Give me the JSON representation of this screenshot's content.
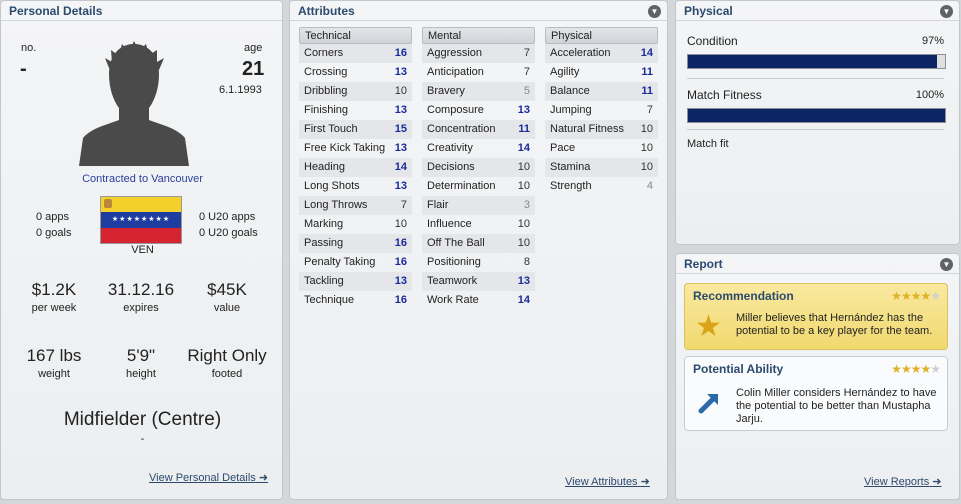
{
  "personal": {
    "title": "Personal Details",
    "no_label": "no.",
    "no_value": "-",
    "age_label": "age",
    "age_value": "21",
    "dob": "6.1.1993",
    "contract": "Contracted to Vancouver",
    "apps": "0 apps",
    "goals": "0 goals",
    "u20_apps": "0 U20 apps",
    "u20_goals": "0 U20 goals",
    "nation": "VEN",
    "wage_value": "$1.2K",
    "wage_label": "per week",
    "expires_value": "31.12.16",
    "expires_label": "expires",
    "value_value": "$45K",
    "value_label": "value",
    "weight_value": "167 lbs",
    "weight_label": "weight",
    "height_value": "5'9\"",
    "height_label": "height",
    "foot_value": "Right Only",
    "foot_label": "footed",
    "position": "Midfielder (Centre)",
    "position_sub": "-",
    "link": "View Personal Details"
  },
  "attributes": {
    "title": "Attributes",
    "link": "View Attributes",
    "technical": {
      "label": "Technical",
      "rows": [
        {
          "name": "Corners",
          "value": "16"
        },
        {
          "name": "Crossing",
          "value": "13"
        },
        {
          "name": "Dribbling",
          "value": "10"
        },
        {
          "name": "Finishing",
          "value": "13"
        },
        {
          "name": "First Touch",
          "value": "15"
        },
        {
          "name": "Free Kick Taking",
          "value": "13"
        },
        {
          "name": "Heading",
          "value": "14"
        },
        {
          "name": "Long Shots",
          "value": "13"
        },
        {
          "name": "Long Throws",
          "value": "7"
        },
        {
          "name": "Marking",
          "value": "10"
        },
        {
          "name": "Passing",
          "value": "16"
        },
        {
          "name": "Penalty Taking",
          "value": "16"
        },
        {
          "name": "Tackling",
          "value": "13"
        },
        {
          "name": "Technique",
          "value": "16"
        }
      ]
    },
    "mental": {
      "label": "Mental",
      "rows": [
        {
          "name": "Aggression",
          "value": "7"
        },
        {
          "name": "Anticipation",
          "value": "7"
        },
        {
          "name": "Bravery",
          "value": "5"
        },
        {
          "name": "Composure",
          "value": "13"
        },
        {
          "name": "Concentration",
          "value": "11"
        },
        {
          "name": "Creativity",
          "value": "14"
        },
        {
          "name": "Decisions",
          "value": "10"
        },
        {
          "name": "Determination",
          "value": "10"
        },
        {
          "name": "Flair",
          "value": "3"
        },
        {
          "name": "Influence",
          "value": "10"
        },
        {
          "name": "Off The Ball",
          "value": "10"
        },
        {
          "name": "Positioning",
          "value": "8"
        },
        {
          "name": "Teamwork",
          "value": "13"
        },
        {
          "name": "Work Rate",
          "value": "14"
        }
      ]
    },
    "physical": {
      "label": "Physical",
      "rows": [
        {
          "name": "Acceleration",
          "value": "14"
        },
        {
          "name": "Agility",
          "value": "11"
        },
        {
          "name": "Balance",
          "value": "11"
        },
        {
          "name": "Jumping",
          "value": "7"
        },
        {
          "name": "Natural Fitness",
          "value": "10"
        },
        {
          "name": "Pace",
          "value": "10"
        },
        {
          "name": "Stamina",
          "value": "10"
        },
        {
          "name": "Strength",
          "value": "4"
        }
      ]
    }
  },
  "physical": {
    "title": "Physical",
    "condition_label": "Condition",
    "condition_value": "97%",
    "condition_level": 0.97,
    "fitness_label": "Match Fitness",
    "fitness_value": "100%",
    "fitness_level": 1.0,
    "status": "Match fit"
  },
  "report": {
    "title": "Report",
    "link": "View Reports",
    "recommendation": {
      "title": "Recommendation",
      "text": "Miller believes that Hernández has the potential to be a key player for the team.",
      "stars": 4,
      "max_stars": 5
    },
    "potential": {
      "title": "Potential Ability",
      "text": "Colin Miller considers Hernández to have the potential to be better than Mustapha Jarju.",
      "stars": 4,
      "max_stars": 5
    }
  },
  "colors": {
    "accent": "#2b4a6e",
    "high_value": "#1a2a9c",
    "bar_fill": "#0c2565",
    "recommendation_bg": "#f7e38a"
  }
}
